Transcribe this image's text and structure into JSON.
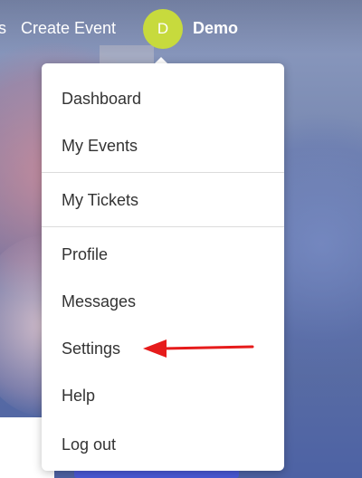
{
  "navbar": {
    "partial_link": "s",
    "create_event_label": "Create Event",
    "avatar_initial": "D",
    "avatar_color": "#c7da3d",
    "user_name": "Demo"
  },
  "menu": {
    "items": [
      {
        "label": "Dashboard"
      },
      {
        "label": "My Events"
      },
      {
        "label": "My Tickets"
      },
      {
        "label": "Profile"
      },
      {
        "label": "Messages"
      },
      {
        "label": "Settings"
      },
      {
        "label": "Help"
      },
      {
        "label": "Log out"
      }
    ]
  },
  "annotation": {
    "arrow_color": "#e61b1b",
    "points_to": "Settings"
  }
}
